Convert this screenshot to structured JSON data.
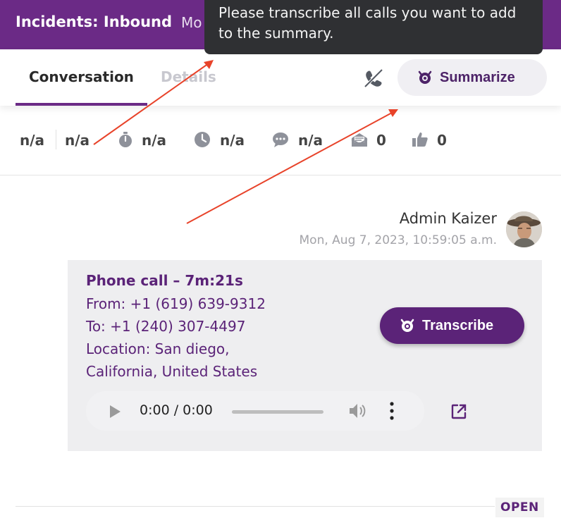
{
  "header": {
    "title": "Incidents: Inbound",
    "more_text": "Mo"
  },
  "tooltip": {
    "text": "Please transcribe all calls you want to add to the summary."
  },
  "tabs": [
    {
      "label": "Conversation",
      "active": true
    },
    {
      "label": "Details",
      "active": false
    }
  ],
  "toolbar": {
    "summarize_label": "Summarize"
  },
  "stats": [
    {
      "icon": "none",
      "value": "n/a"
    },
    {
      "icon": "none",
      "value": "n/a"
    },
    {
      "icon": "stopwatch-icon",
      "value": "n/a"
    },
    {
      "icon": "clock-icon",
      "value": "n/a"
    },
    {
      "icon": "chat-bubble-icon",
      "value": "n/a"
    },
    {
      "icon": "envelope-icon",
      "value": "0"
    },
    {
      "icon": "thumbs-up-icon",
      "value": "0"
    }
  ],
  "message": {
    "author": "Admin Kaizer",
    "timestamp": "Mon, Aug 7, 2023, 10:59:05 a.m.",
    "call_title": "Phone call – 7m:21s",
    "from": "From: +1 (619) 639-9312",
    "to": "To: +1 (240) 307-4497",
    "location_line1": "Location: San diego,",
    "location_line2": "California, United States",
    "transcribe_label": "Transcribe",
    "player_time": "0:00 / 0:00"
  },
  "footer": {
    "status_badge": "OPEN"
  },
  "colors": {
    "brand_purple": "#6b2a86",
    "text_purple": "#5b2378",
    "tooltip_bg": "#2f3033",
    "annotation_red": "#e8432a"
  }
}
